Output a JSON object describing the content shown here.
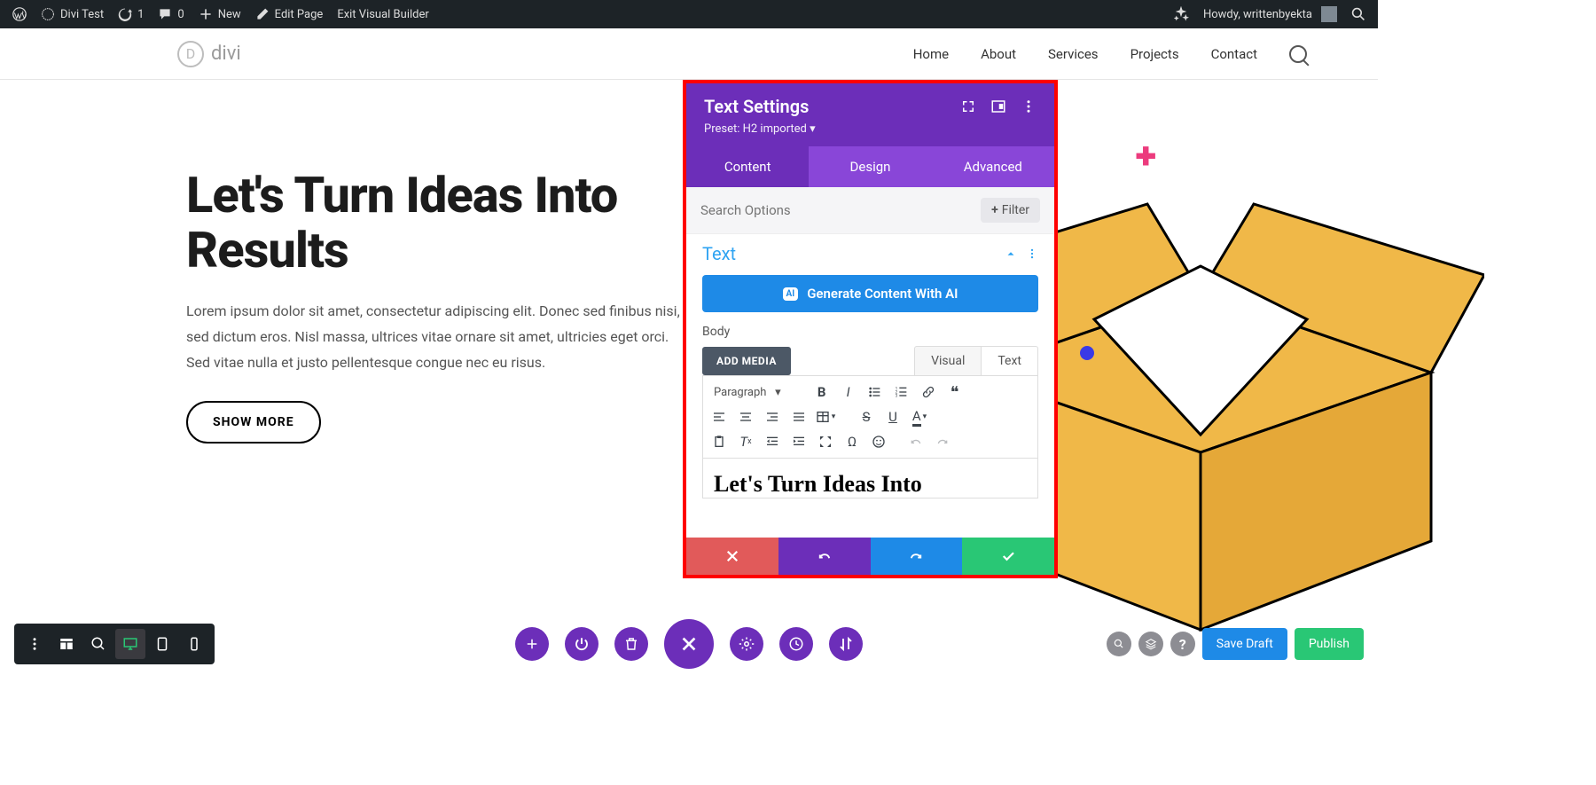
{
  "wp_bar": {
    "site": "Divi Test",
    "updates": "1",
    "comments": "0",
    "new": "New",
    "edit": "Edit Page",
    "exit": "Exit Visual Builder",
    "howdy": "Howdy, writtenbyekta"
  },
  "logo": "divi",
  "nav": [
    "Home",
    "About",
    "Services",
    "Projects",
    "Contact"
  ],
  "hero": {
    "title": "Let's Turn Ideas Into Results",
    "body": "Lorem ipsum dolor sit amet, consectetur adipiscing elit. Donec sed finibus nisi, sed dictum eros. Nisl massa, ultrices vitae ornare sit amet, ultricies eget orci. Sed vitae nulla et justo pellentesque congue nec eu risus.",
    "cta": "SHOW MORE"
  },
  "modal": {
    "title": "Text Settings",
    "preset": "Preset: H2 imported ▾",
    "tabs": [
      "Content",
      "Design",
      "Advanced"
    ],
    "search_placeholder": "Search Options",
    "filter": "Filter",
    "section": "Text",
    "generate": "Generate Content With AI",
    "body_label": "Body",
    "add_media": "ADD MEDIA",
    "ed_tabs": [
      "Visual",
      "Text"
    ],
    "format": "Paragraph",
    "editor_preview": "Let's Turn Ideas Into"
  },
  "bottom": {
    "save_draft": "Save Draft",
    "publish": "Publish"
  }
}
